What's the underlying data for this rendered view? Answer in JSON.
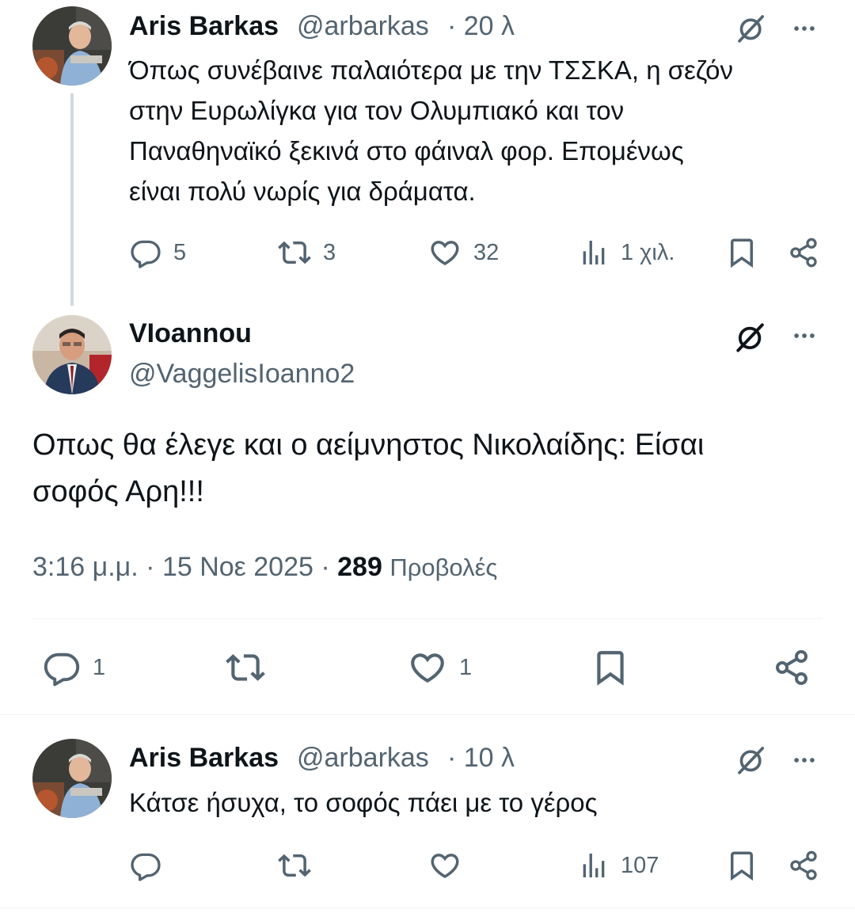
{
  "tweets": [
    {
      "author": "Aris Barkas",
      "handle": "@arbarkas",
      "time": "· 20 λ",
      "text_lines": [
        "Όπως συνέβαινε παλαιότερα με την ΤΣΣΚΑ, η σεζόν",
        "στην Ευρωλίγκα για τον Ολυμπιακό και τον",
        "Παναθηναϊκό ξεκινά στο φάιναλ φορ. Επομένως",
        "είναι πολύ νωρίς για δράματα."
      ],
      "replies": "5",
      "retweets": "3",
      "likes": "32",
      "views": "1 χιλ."
    },
    {
      "author": "Aris Barkas",
      "handle": "@arbarkas",
      "time": "· 10 λ",
      "text_lines": [
        "Κάτσε ήσυχα, το σοφός πάει με το γέρος"
      ],
      "views": "107"
    }
  ],
  "main": {
    "author": "VIoannou",
    "handle": "@VaggelisIoanno2",
    "text_lines": [
      "Οπως θα έλεγε και ο αείμνηστος Νικολαίδης: Είσαι",
      "σοφός Αρη!!!"
    ],
    "time": "3:16 μ.μ.",
    "date": "15 Νοε 2025",
    "views_count": "289",
    "views_label": "Προβολές",
    "replies": "1",
    "likes": "1"
  },
  "icons": {
    "more": "more-horizontal-icon",
    "grok": "grok-icon",
    "reply": "reply-icon",
    "retweet": "retweet-icon",
    "like": "heart-icon",
    "views": "views-icon",
    "bookmark": "bookmark-icon",
    "share": "share-icon"
  },
  "colors": {
    "text": "#0f1419",
    "secondary": "#536471",
    "divider": "#eff3f4",
    "thread_line": "#cfd9de"
  }
}
